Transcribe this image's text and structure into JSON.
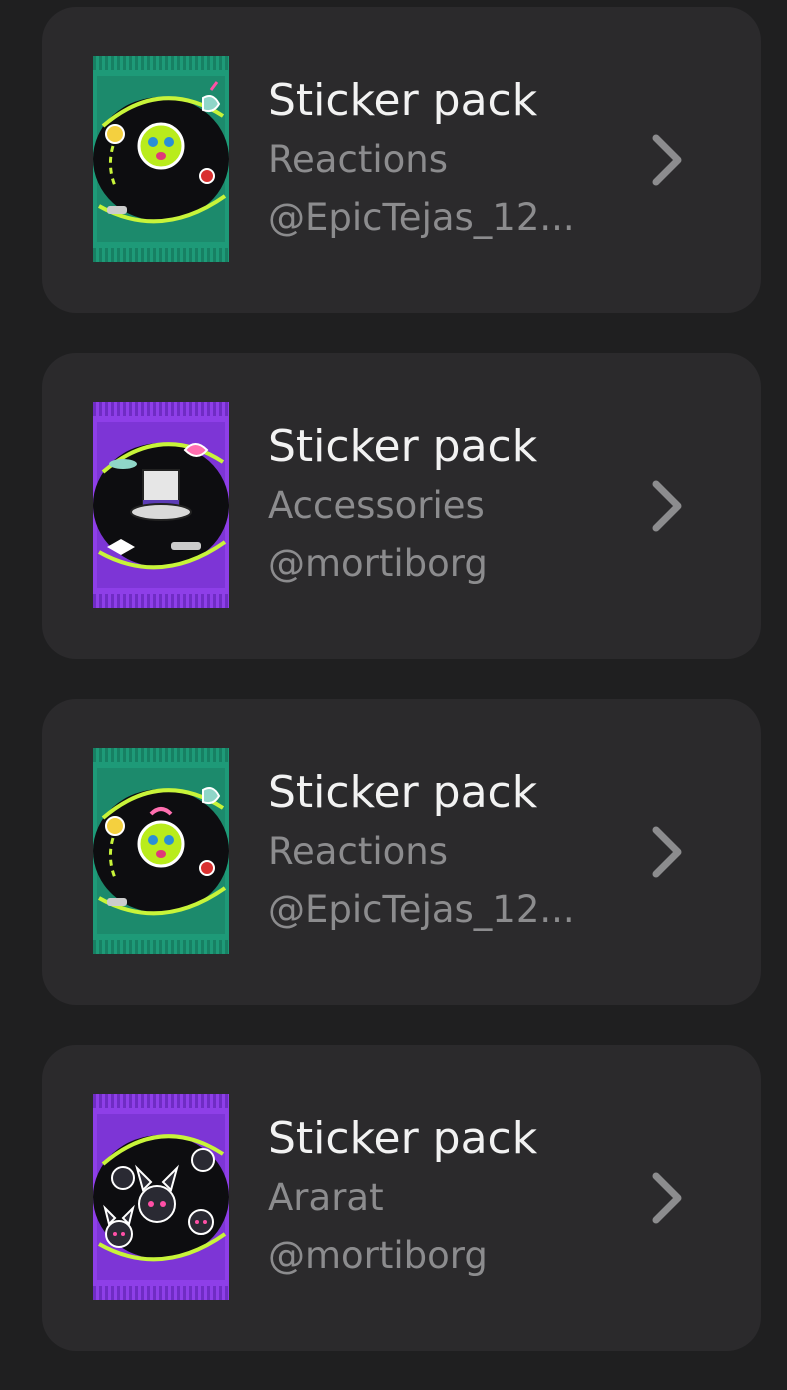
{
  "packs": [
    {
      "title": "Sticker pack",
      "category": "Reactions",
      "author": "@EpicTejas_12...",
      "theme": "reactions",
      "color": "#1e9a78"
    },
    {
      "title": "Sticker pack",
      "category": "Accessories",
      "author": "@mortiborg",
      "theme": "accessories",
      "color": "#8e3fe8"
    },
    {
      "title": "Sticker pack",
      "category": "Reactions",
      "author": "@EpicTejas_12...",
      "theme": "reactions",
      "color": "#1e9a78"
    },
    {
      "title": "Sticker pack",
      "category": "Ararat",
      "author": "@mortiborg",
      "theme": "ararat",
      "color": "#8e3fe8"
    }
  ],
  "icons": {
    "chevron": "chevron-right-icon"
  },
  "colors": {
    "background": "#1f1f20",
    "card": "#2b2a2c",
    "title": "#f2f2f2",
    "secondary": "#8c8c8e",
    "accent_lime": "#c8f43a"
  }
}
